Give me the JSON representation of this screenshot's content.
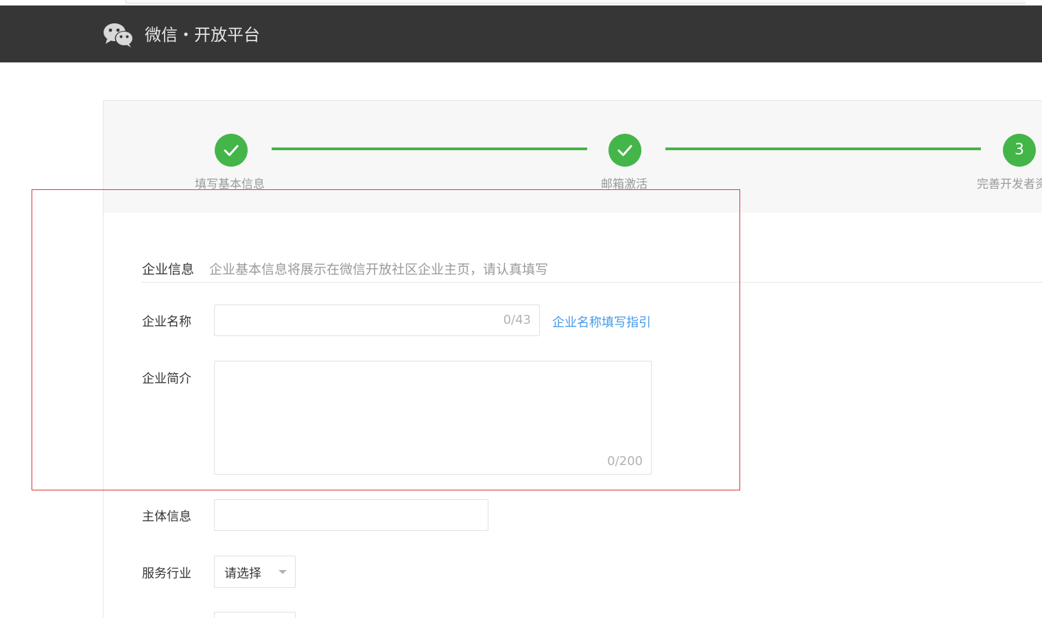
{
  "header": {
    "brand": "微信・开放平台",
    "logo_icon": "wechat-logo-icon"
  },
  "steps": [
    {
      "label": "填写基本信息",
      "state": "done",
      "icon": "check-icon"
    },
    {
      "label": "邮箱激活",
      "state": "done",
      "icon": "check-icon"
    },
    {
      "label": "完善开发者资",
      "state": "current",
      "number": "3"
    }
  ],
  "section": {
    "title": "企业信息",
    "description": "企业基本信息将展示在微信开放社区企业主页，请认真填写"
  },
  "form": {
    "company_name": {
      "label": "企业名称",
      "value": "",
      "counter": "0/43"
    },
    "guide_link": "企业名称填写指引",
    "company_intro": {
      "label": "企业简介",
      "value": "",
      "counter": "0/200"
    },
    "subject_info": {
      "label": "主体信息",
      "value": ""
    },
    "service_industry": {
      "label": "服务行业",
      "selected": "请选择"
    }
  },
  "colors": {
    "header_bg": "#363636",
    "accent_green": "#44b549",
    "link_blue": "#459ae9",
    "annotation_red": "#d9343c"
  }
}
